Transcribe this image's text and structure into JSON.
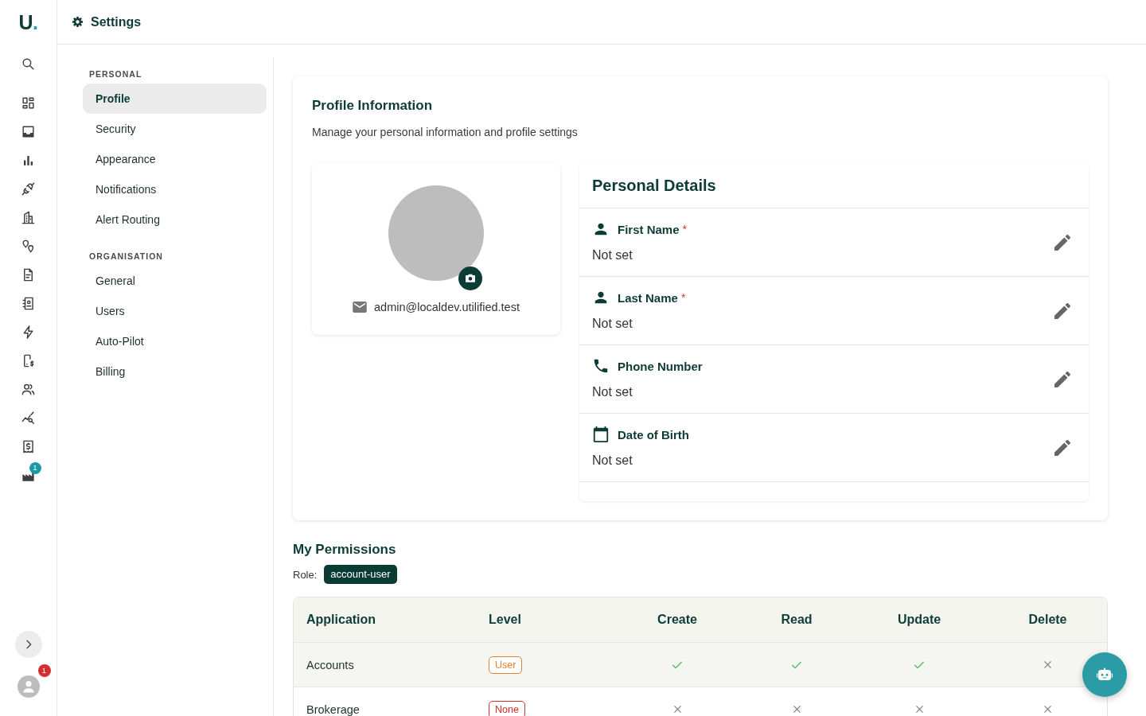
{
  "logo": {
    "text": "U",
    "accent": "."
  },
  "rail": {
    "items": [
      {
        "kind": "search"
      },
      {
        "kind": "dashboard"
      },
      {
        "kind": "inbox"
      },
      {
        "kind": "bar-chart"
      },
      {
        "kind": "plug"
      },
      {
        "kind": "building"
      },
      {
        "kind": "pins"
      },
      {
        "kind": "document"
      },
      {
        "kind": "contacts"
      },
      {
        "kind": "bolt"
      },
      {
        "kind": "phone-dollar"
      },
      {
        "kind": "people"
      },
      {
        "kind": "chart-search"
      },
      {
        "kind": "receipt"
      },
      {
        "kind": "factory",
        "badge": "1"
      }
    ],
    "user_badge": "1"
  },
  "header": {
    "title": "Settings"
  },
  "settings_nav": [
    {
      "heading": "PERSONAL",
      "items": [
        {
          "label": "Profile",
          "selected": true
        },
        {
          "label": "Security",
          "selected": false
        },
        {
          "label": "Appearance",
          "selected": false
        },
        {
          "label": "Notifications",
          "selected": false
        },
        {
          "label": "Alert Routing",
          "selected": false
        }
      ]
    },
    {
      "heading": "ORGANISATION",
      "items": [
        {
          "label": "General",
          "selected": false
        },
        {
          "label": "Users",
          "selected": false
        },
        {
          "label": "Auto-Pilot",
          "selected": false
        },
        {
          "label": "Billing",
          "selected": false
        }
      ]
    }
  ],
  "profile": {
    "title": "Profile Information",
    "subtitle": "Manage your personal information and profile settings",
    "email": "admin@localdev.utilified.test",
    "details": {
      "title": "Personal Details",
      "fields": [
        {
          "kind": "person",
          "label": "First Name",
          "required_mark": "*",
          "value": "Not set"
        },
        {
          "kind": "person",
          "label": "Last Name",
          "required_mark": "*",
          "value": "Not set"
        },
        {
          "kind": "phone",
          "label": "Phone Number",
          "value": "Not set"
        },
        {
          "kind": "calendar",
          "label": "Date of Birth",
          "value": "Not set"
        }
      ]
    }
  },
  "permissions": {
    "title": "My Permissions",
    "role_label": "Role:",
    "role": "account-user",
    "columns": [
      "Application",
      "Level",
      "Create",
      "Read",
      "Update",
      "Delete"
    ],
    "rows": [
      {
        "application": "Accounts",
        "level": {
          "text": "User",
          "color": "#e3802b"
        },
        "grants": [
          true,
          true,
          true,
          false
        ],
        "highlighted": true
      },
      {
        "application": "Brokerage",
        "level": {
          "text": "None",
          "color": "#d32f2f"
        },
        "grants": [
          false,
          false,
          false,
          false
        ],
        "highlighted": false
      }
    ]
  }
}
